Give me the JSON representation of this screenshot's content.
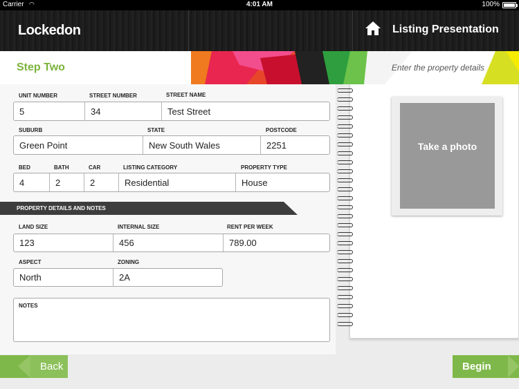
{
  "status_bar": {
    "carrier": "Carrier",
    "wifi_icon": "wifi-icon",
    "time": "4:01 AM",
    "battery_percent": "100%",
    "battery_level": 1.0
  },
  "header": {
    "logo": "Lockedon",
    "home_icon": "home-icon",
    "title": "Listing Presentation"
  },
  "step": {
    "title": "Step Two",
    "hint": "Enter the property details"
  },
  "address": {
    "unit_number_label": "UNIT NUMBER",
    "unit_number": "5",
    "street_number_label": "STREET NUMBER",
    "street_number": "34",
    "street_name_label": "STREET NAME",
    "street_name": "Test Street",
    "suburb_label": "SUBURB",
    "suburb": "Green Point",
    "state_label": "STATE",
    "state": "New South Wales",
    "postcode_label": "POSTCODE",
    "postcode": "2251"
  },
  "features": {
    "bed_label": "BED",
    "bed": "4",
    "bath_label": "BATH",
    "bath": "2",
    "car_label": "CAR",
    "car": "2",
    "listing_category_label": "LISTING CATEGORY",
    "listing_category": "Residential",
    "property_type_label": "PROPERTY TYPE",
    "property_type": "House"
  },
  "details": {
    "section_title": "PROPERTY DETAILS AND NOTES",
    "land_size_label": "LAND SIZE",
    "land_size": "123",
    "internal_size_label": "INTERNAL SIZE",
    "internal_size": "456",
    "rent_label": "RENT PER WEEK",
    "rent": "789.00",
    "aspect_label": "ASPECT",
    "aspect": "North",
    "zoning_label": "ZONING",
    "zoning": "2A",
    "notes_label": "NOTES",
    "notes": ""
  },
  "photo": {
    "label": "Take a photo"
  },
  "buttons": {
    "back": "Back",
    "begin": "Begin"
  },
  "colors": {
    "accent_green": "#7fb84a",
    "header_dark": "#1c1c1c",
    "section_bar": "#3d3d3d",
    "photo_placeholder": "#999999"
  }
}
